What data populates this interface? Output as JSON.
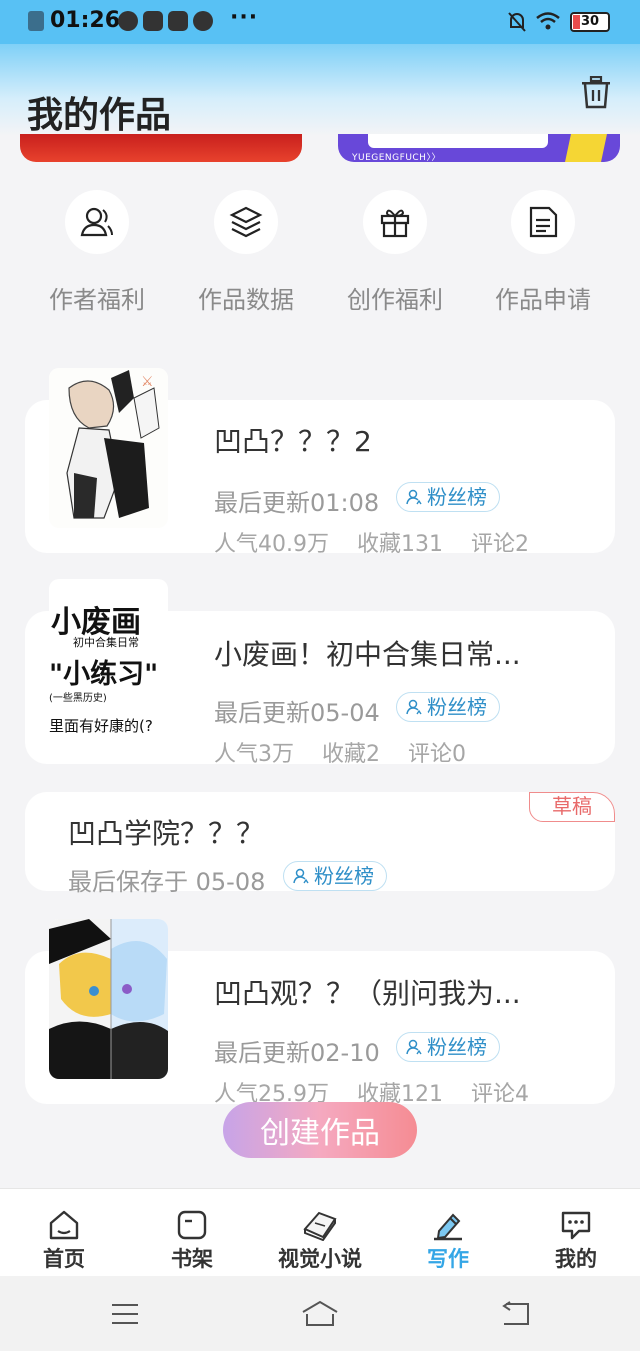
{
  "status_bar": {
    "time": "01:26",
    "dots": "···",
    "battery": "30"
  },
  "header": {
    "title": "我的作品"
  },
  "banners": {
    "right_text": "YUEGENGFUCH〉〉"
  },
  "quick_actions": [
    {
      "label": "作者福利",
      "icon": "user-icon"
    },
    {
      "label": "作品数据",
      "icon": "layers-icon"
    },
    {
      "label": "创作福利",
      "icon": "gift-icon"
    },
    {
      "label": "作品申请",
      "icon": "document-icon"
    }
  ],
  "works": [
    {
      "title": "凹凸？？？2",
      "updated": "最后更新01:08",
      "fan_label": "粉丝榜",
      "popularity": "人气40.9万",
      "favorites": "收藏131",
      "comments": "评论2"
    },
    {
      "title": "小废画！初中合集日常...",
      "updated": "最后更新05-04",
      "fan_label": "粉丝榜",
      "popularity": "人气3万",
      "favorites": "收藏2",
      "comments": "评论0",
      "cover_text": {
        "line1": "小废画",
        "line2": "初中合集日常",
        "line3": "\"小练习\"",
        "line4": "(一些黑历史)",
        "line5": "里面有好康的(?"
      }
    },
    {
      "title": "凹凸观？？（别问我为...",
      "updated": "最后更新02-10",
      "fan_label": "粉丝榜",
      "popularity": "人气25.9万",
      "favorites": "收藏121",
      "comments": "评论4"
    }
  ],
  "draft": {
    "title": "凹凸学院？？？",
    "saved": "最后保存于 05-08",
    "fan_label": "粉丝榜",
    "tag": "草稿"
  },
  "create_button": "创建作品",
  "tabs": [
    {
      "label": "首页",
      "icon": "home-icon",
      "active": false
    },
    {
      "label": "书架",
      "icon": "bookshelf-icon",
      "active": false
    },
    {
      "label": "视觉小说",
      "icon": "book-icon",
      "active": false
    },
    {
      "label": "写作",
      "icon": "pen-icon",
      "active": true
    },
    {
      "label": "我的",
      "icon": "chat-icon",
      "active": false
    }
  ],
  "colors": {
    "accent": "#34a6e6",
    "status_bar": "#58c1f4",
    "draft_tag": "#e86a6a"
  }
}
